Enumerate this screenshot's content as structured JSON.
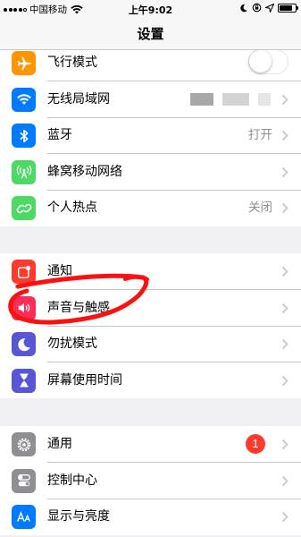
{
  "status_bar": {
    "carrier": "中国移动",
    "time": "上午9:02"
  },
  "nav": {
    "title": "设置"
  },
  "group1": [
    {
      "name": "airplane",
      "label": "飞行模式",
      "icon": "airplane-icon",
      "color": "#ff9500",
      "accessory": "toggle",
      "toggle_on": false
    },
    {
      "name": "wifi",
      "label": "无线局域网",
      "icon": "wifi-icon",
      "color": "#007aff",
      "accessory": "blurred"
    },
    {
      "name": "bluetooth",
      "label": "蓝牙",
      "icon": "bluetooth-icon",
      "color": "#007aff",
      "value": "打开"
    },
    {
      "name": "cellular",
      "label": "蜂窝移动网络",
      "icon": "cellular-icon",
      "color": "#4cd964"
    },
    {
      "name": "hotspot",
      "label": "个人热点",
      "icon": "hotspot-icon",
      "color": "#4cd964",
      "value": "关闭"
    }
  ],
  "group2": [
    {
      "name": "notifications",
      "label": "通知",
      "icon": "notifications-icon",
      "color": "#ff3b30"
    },
    {
      "name": "sounds",
      "label": "声音与触感",
      "icon": "speaker-icon",
      "color": "#ff2d55"
    },
    {
      "name": "do-not-disturb",
      "label": "勿扰模式",
      "icon": "moon-icon",
      "color": "#5856d6"
    },
    {
      "name": "screen-time",
      "label": "屏幕使用时间",
      "icon": "hourglass-icon",
      "color": "#5856d6"
    }
  ],
  "group3": [
    {
      "name": "general",
      "label": "通用",
      "icon": "gear-icon",
      "color": "#8e8e93",
      "badge": "1"
    },
    {
      "name": "control-center",
      "label": "控制中心",
      "icon": "switches-icon",
      "color": "#8e8e93"
    },
    {
      "name": "display",
      "label": "显示与亮度",
      "icon": "display-aa-icon",
      "color": "#007aff"
    }
  ],
  "colors": {
    "annotation": "#ff1010",
    "badge": "#ff3b30"
  }
}
